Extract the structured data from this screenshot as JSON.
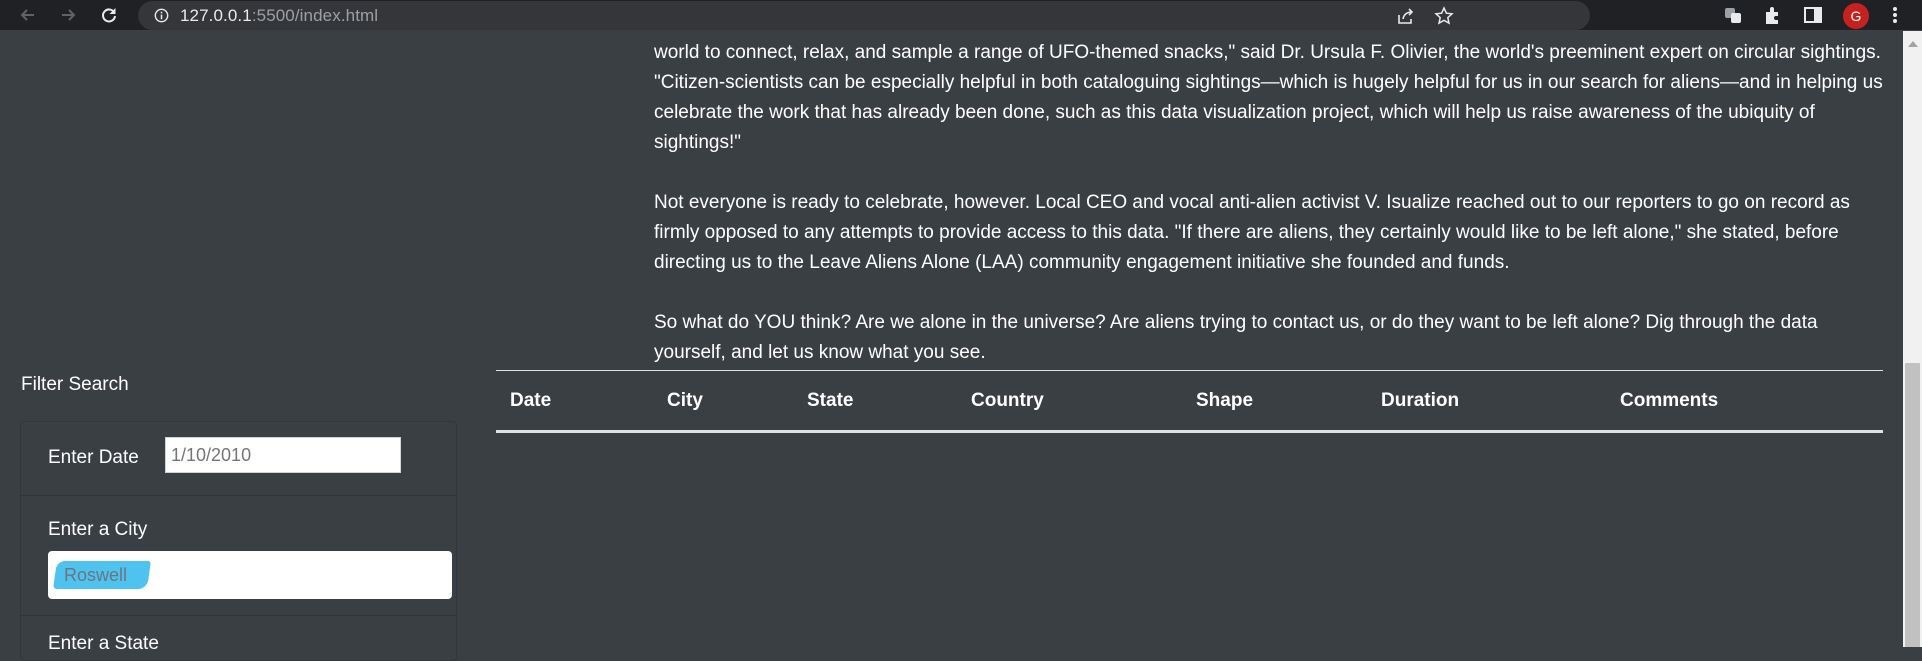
{
  "browser": {
    "url_host": "127.0.0.1",
    "url_rest": ":5500/index.html",
    "avatar_initial": "G"
  },
  "article": {
    "paragraphs": [
      "world to connect, relax, and sample a range of UFO-themed snacks,\" said Dr. Ursula F. Olivier, the world's preeminent expert on circular sightings. \"Citizen-scientists can be especially helpful in both cataloguing sightings—which is hugely helpful for us in our search for aliens—and in helping us celebrate the work that has already been done, such as this data visualization project, which will help us raise awareness of the ubiquity of sightings!\"",
      "Not everyone is ready to celebrate, however. Local CEO and vocal anti-alien activist V. Isualize reached out to our reporters to go on record as firmly opposed to any attempts to provide access to this data. \"If there are aliens, they certainly would like to be left alone,\" she stated, before directing us to the Leave Aliens Alone (LAA) community engagement initiative she founded and funds.",
      "So what do YOU think? Are we alone in the universe? Are aliens trying to contact us, or do they want to be left alone? Dig through the data yourself, and let us know what you see."
    ]
  },
  "filters": {
    "title": "Filter Search",
    "date_label": "Enter Date",
    "date_placeholder": "1/10/2010",
    "city_label": "Enter a City",
    "city_placeholder": "Roswell",
    "state_label": "Enter a State"
  },
  "table": {
    "headers": [
      "Date",
      "City",
      "State",
      "Country",
      "Shape",
      "Duration",
      "Comments"
    ]
  },
  "colors": {
    "page_bg": "#3a3f44",
    "chrome_bg": "#202124",
    "highlight": "#4fc3f0",
    "avatar": "#c5221f"
  }
}
